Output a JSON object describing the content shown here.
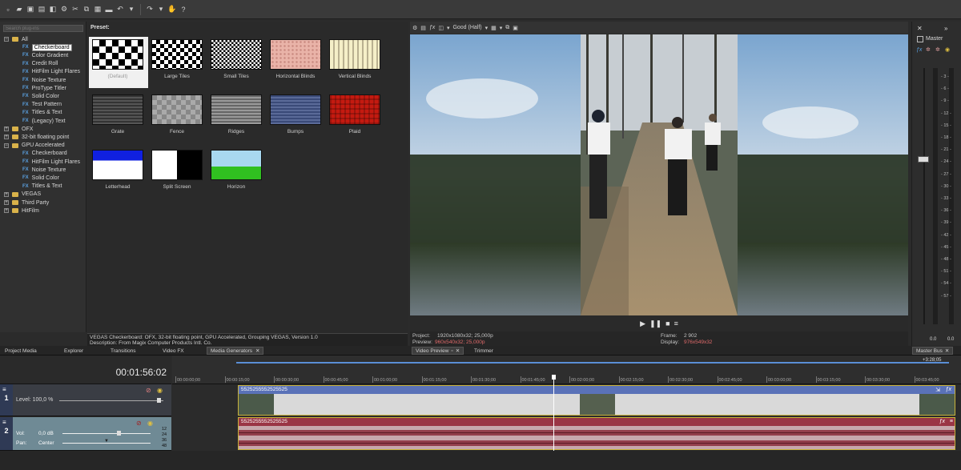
{
  "plugin_tree": {
    "search_placeholder": "Search plug-ins",
    "items": [
      {
        "label": "All",
        "level": 0,
        "kind": "folder",
        "expanded": true
      },
      {
        "label": "Checkerboard",
        "level": 1,
        "kind": "fx",
        "selected": true
      },
      {
        "label": "Color Gradient",
        "level": 1,
        "kind": "fx"
      },
      {
        "label": "Credit Roll",
        "level": 1,
        "kind": "fx"
      },
      {
        "label": "HitFilm Light Flares",
        "level": 1,
        "kind": "fx"
      },
      {
        "label": "Noise Texture",
        "level": 1,
        "kind": "fx"
      },
      {
        "label": "ProType Titler",
        "level": 1,
        "kind": "fx"
      },
      {
        "label": "Solid Color",
        "level": 1,
        "kind": "fx"
      },
      {
        "label": "Test Pattern",
        "level": 1,
        "kind": "fx"
      },
      {
        "label": "Titles & Text",
        "level": 1,
        "kind": "fx"
      },
      {
        "label": "(Legacy) Text",
        "level": 1,
        "kind": "fx"
      },
      {
        "label": "OFX",
        "level": 0,
        "kind": "folder",
        "expanded": false
      },
      {
        "label": "32-bit floating point",
        "level": 0,
        "kind": "folder",
        "expanded": false
      },
      {
        "label": "GPU Accelerated",
        "level": 0,
        "kind": "folder",
        "expanded": true
      },
      {
        "label": "Checkerboard",
        "level": 1,
        "kind": "fx"
      },
      {
        "label": "HitFilm Light Flares",
        "level": 1,
        "kind": "fx"
      },
      {
        "label": "Noise Texture",
        "level": 1,
        "kind": "fx"
      },
      {
        "label": "Solid Color",
        "level": 1,
        "kind": "fx"
      },
      {
        "label": "Titles & Text",
        "level": 1,
        "kind": "fx"
      },
      {
        "label": "VEGAS",
        "level": 0,
        "kind": "folder",
        "expanded": false
      },
      {
        "label": "Third Party",
        "level": 0,
        "kind": "folder",
        "expanded": false
      },
      {
        "label": "HitFilm",
        "level": 0,
        "kind": "folder",
        "expanded": false
      }
    ]
  },
  "presets": {
    "heading": "Preset:",
    "items": [
      {
        "label": "(Default)",
        "pattern": "checker-large"
      },
      {
        "label": "Large Tiles",
        "pattern": "checker-medium"
      },
      {
        "label": "Small Tiles",
        "pattern": "checker-small"
      },
      {
        "label": "Horizontal Blinds",
        "pattern": "blinds-h"
      },
      {
        "label": "Vertical Blinds",
        "pattern": "blinds-v"
      },
      {
        "label": "Grate",
        "pattern": "grate"
      },
      {
        "label": "Fence",
        "pattern": "fence"
      },
      {
        "label": "Ridges",
        "pattern": "ridges"
      },
      {
        "label": "Bumps",
        "pattern": "bumps"
      },
      {
        "label": "Plaid",
        "pattern": "plaid"
      },
      {
        "label": "Letterhead",
        "pattern": "letterhead"
      },
      {
        "label": "Split Screen",
        "pattern": "split"
      },
      {
        "label": "Horizon",
        "pattern": "horizon"
      }
    ],
    "description_line1": "VEGAS Checkerboard: OFX, 32-bit floating point, GPU Accelerated, Grouping VEGAS, Version 1.0",
    "description_line2": "Description: From Magix Computer Products Intl. Co."
  },
  "tabs": {
    "project_media": "Project Media",
    "explorer": "Explorer",
    "transitions": "Transitions",
    "video_fx": "Video FX",
    "media_generators": "Media Generators",
    "video_preview": "Video Preview",
    "trimmer": "Trimmer",
    "master_bus": "Master Bus"
  },
  "preview": {
    "quality": "Good (Half)",
    "project_label": "Project:",
    "project_value": "1920x1080x32; 25,000p",
    "preview_label": "Preview:",
    "preview_value": "960x540x32; 25,000p",
    "frame_label": "Frame:",
    "frame_value": "2 902",
    "display_label": "Display:",
    "display_value": "976x549x32"
  },
  "master": {
    "title": "Master",
    "scale": [
      "3",
      "6",
      "9",
      "12",
      "15",
      "18",
      "21",
      "24",
      "27",
      "30",
      "33",
      "36",
      "39",
      "42",
      "45",
      "48",
      "51",
      "54",
      "57"
    ],
    "readout_left": "0.0",
    "readout_right": "0.0"
  },
  "timeline": {
    "timecode": "00:01:56:02",
    "ruler": [
      "00:00:00;00",
      "00:00:15;00",
      "00:00:30;00",
      "00:00:45;00",
      "00:01:00;00",
      "00:01:15;00",
      "00:01:30;00",
      "00:01:45;00",
      "00:02:00;00",
      "00:02:15;00",
      "00:02:30;00",
      "00:02:45;00",
      "00:03:00;00",
      "00:03:15;00",
      "00:03:30;00",
      "00:03:45;00"
    ],
    "end_marker": "+3:28;05",
    "video_track": {
      "number": "1",
      "level_label": "Level: 100,0 %",
      "clip_name": "5525255552525525"
    },
    "audio_track": {
      "number": "2",
      "vol_label": "Vol:",
      "vol_value": "0,0 dB",
      "pan_label": "Pan:",
      "pan_value": "Center",
      "meter_values": [
        "12",
        "24",
        "36",
        "48"
      ],
      "clip_name": "5525255552525525"
    }
  }
}
